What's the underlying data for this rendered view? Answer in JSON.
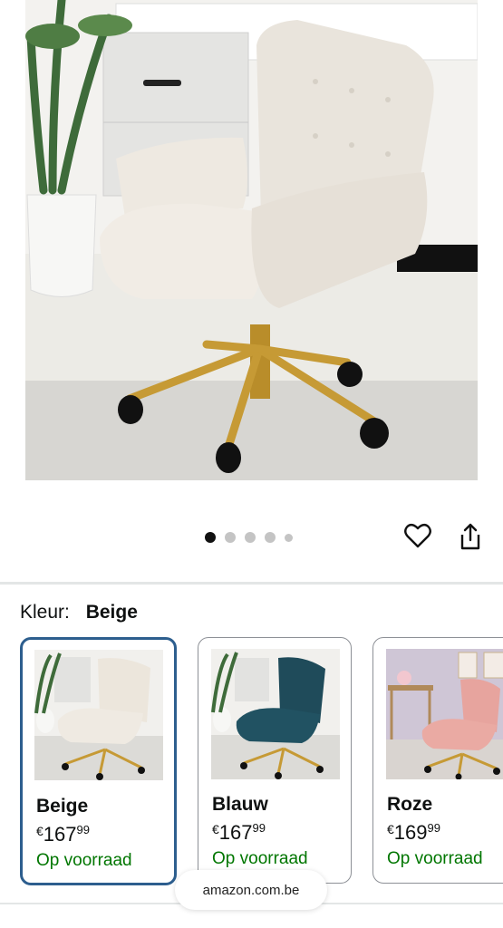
{
  "gallery": {
    "dots": [
      true,
      false,
      false,
      false,
      false
    ]
  },
  "color_selector": {
    "label": "Kleur:",
    "selected_value": "Beige",
    "options": [
      {
        "name": "Beige",
        "currency": "€",
        "whole": "167",
        "cents": "99",
        "stock": "Op voorraad",
        "swatch": "#ece6dc"
      },
      {
        "name": "Blauw",
        "currency": "€",
        "whole": "167",
        "cents": "99",
        "stock": "Op voorraad",
        "swatch": "#1f4b5a"
      },
      {
        "name": "Roze",
        "currency": "€",
        "whole": "169",
        "cents": "99",
        "stock": "Op voorraad",
        "swatch": "#e7a49e"
      }
    ]
  },
  "browser": {
    "domain": "amazon.com.be"
  },
  "colors": {
    "selected_border": "#2d5e8e",
    "in_stock": "#007600"
  }
}
